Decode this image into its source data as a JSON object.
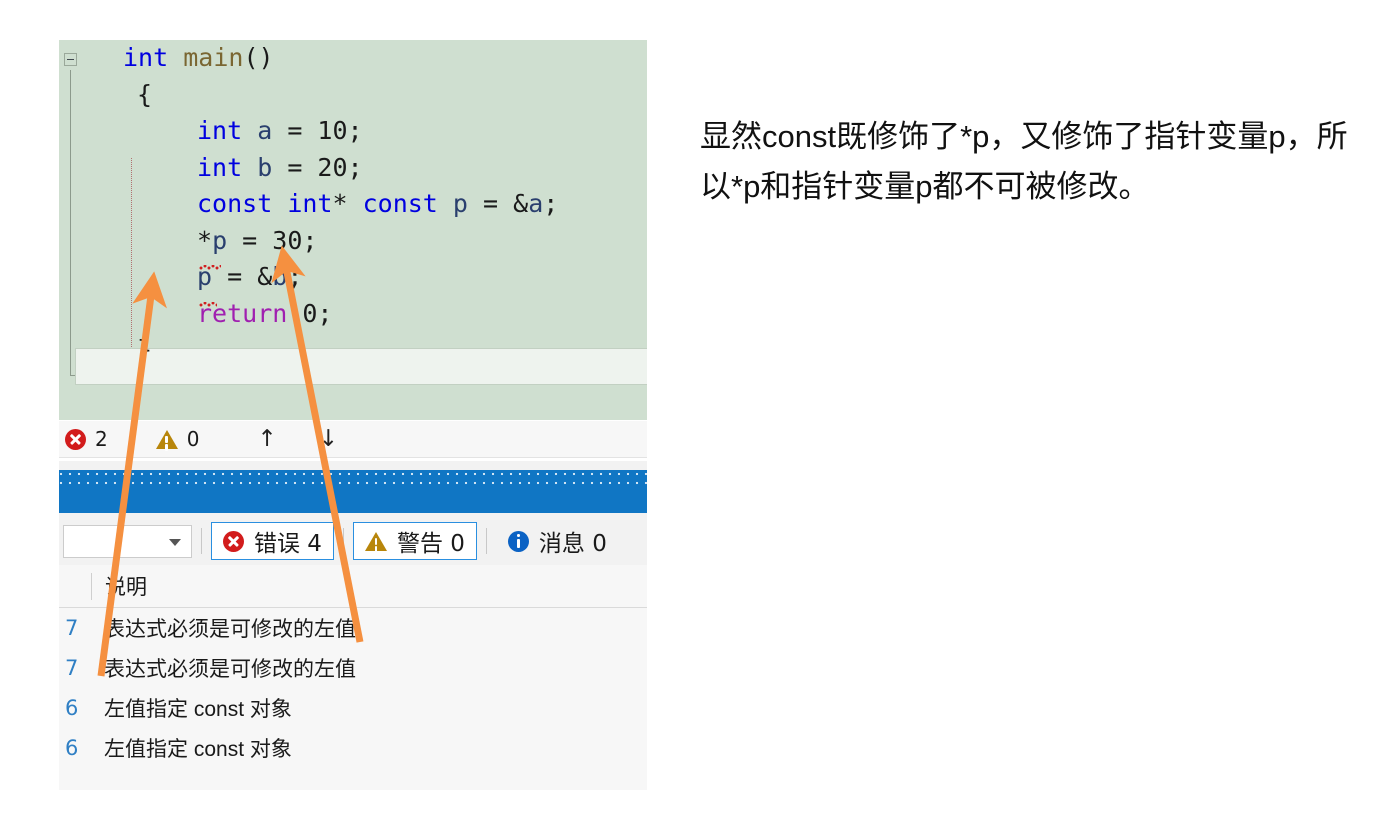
{
  "editor": {
    "collapse_icon": "minus-collapse-icon",
    "lines": [
      {
        "indent": 0,
        "tokens": [
          {
            "t": "int",
            "c": "kw"
          },
          {
            "t": " ",
            "c": "punc"
          },
          {
            "t": "main",
            "c": "fn"
          },
          {
            "t": "()",
            "c": "punc"
          }
        ]
      },
      {
        "indent": 1,
        "tokens": [
          {
            "t": "{",
            "c": "punc"
          }
        ]
      },
      {
        "indent": 2,
        "tokens": [
          {
            "t": "int",
            "c": "kw"
          },
          {
            "t": " ",
            "c": "punc"
          },
          {
            "t": "a",
            "c": "var"
          },
          {
            "t": " = 10;",
            "c": "punc"
          }
        ]
      },
      {
        "indent": 2,
        "tokens": [
          {
            "t": "int",
            "c": "kw"
          },
          {
            "t": " ",
            "c": "punc"
          },
          {
            "t": "b",
            "c": "var"
          },
          {
            "t": " = 20;",
            "c": "punc"
          }
        ]
      },
      {
        "indent": 2,
        "tokens": [
          {
            "t": "const",
            "c": "kw"
          },
          {
            "t": " ",
            "c": "punc"
          },
          {
            "t": "int",
            "c": "kw"
          },
          {
            "t": "* ",
            "c": "punc"
          },
          {
            "t": "const",
            "c": "kw"
          },
          {
            "t": " ",
            "c": "punc"
          },
          {
            "t": "p",
            "c": "var"
          },
          {
            "t": " = &",
            "c": "punc"
          },
          {
            "t": "a",
            "c": "var"
          },
          {
            "t": ";",
            "c": "punc"
          }
        ]
      },
      {
        "indent": 2,
        "tokens": [
          {
            "t": "*",
            "c": "punc"
          },
          {
            "t": "p",
            "c": "var"
          },
          {
            "t": " = 30;",
            "c": "punc"
          }
        ]
      },
      {
        "indent": 2,
        "tokens": [
          {
            "t": "p",
            "c": "var"
          },
          {
            "t": " = &",
            "c": "punc"
          },
          {
            "t": "b",
            "c": "var"
          },
          {
            "t": ";",
            "c": "punc"
          }
        ]
      },
      {
        "indent": 2,
        "tokens": [
          {
            "t": "return",
            "c": "kw-ctl"
          },
          {
            "t": " 0;",
            "c": "punc"
          }
        ]
      },
      {
        "indent": 1,
        "tokens": [
          {
            "t": "}",
            "c": "punc"
          }
        ]
      }
    ]
  },
  "status_strip": {
    "error_icon": "error-circle-icon",
    "error_count": "2",
    "warning_icon": "warning-triangle-icon",
    "warning_count": "0",
    "prev_arrow": "↑",
    "next_arrow": "↓"
  },
  "error_list_toolbar": {
    "filter_value": "",
    "filter_placeholder": "",
    "caret_icon": "chevron-down-icon",
    "errors": {
      "icon": "error-circle-icon",
      "label": "错误 4"
    },
    "warnings": {
      "icon": "warning-triangle-icon",
      "label": "警告 0"
    },
    "messages": {
      "icon": "info-circle-icon",
      "label": "消息 0"
    }
  },
  "error_list": {
    "columns": [
      "",
      "说明"
    ],
    "rows": [
      {
        "line": "7",
        "description": "表达式必须是可修改的左值"
      },
      {
        "line": "7",
        "description": "表达式必须是可修改的左值"
      },
      {
        "line": "6",
        "description": "左值指定 const 对象"
      },
      {
        "line": "6",
        "description": "左值指定 const 对象"
      }
    ]
  },
  "annotations": {
    "arrow_color": "#f59040",
    "arrows": [
      "arrow-to-p-assign",
      "arrow-to-deref-assign"
    ]
  },
  "note": {
    "text": "显然const既修饰了*p，又修饰了指针变量p，所以*p和指针变量p都不可被修改。"
  },
  "colors": {
    "code_background": "#cfdfd0",
    "keyword": "#0000e0",
    "control_keyword": "#a020b0",
    "function": "#7a6632",
    "error_red": "#d21c1c",
    "warning_gold": "#b8860b",
    "info_blue": "#0b62c4",
    "progress_blue": "#1076c4",
    "line_number_blue": "#2f7fc4"
  }
}
